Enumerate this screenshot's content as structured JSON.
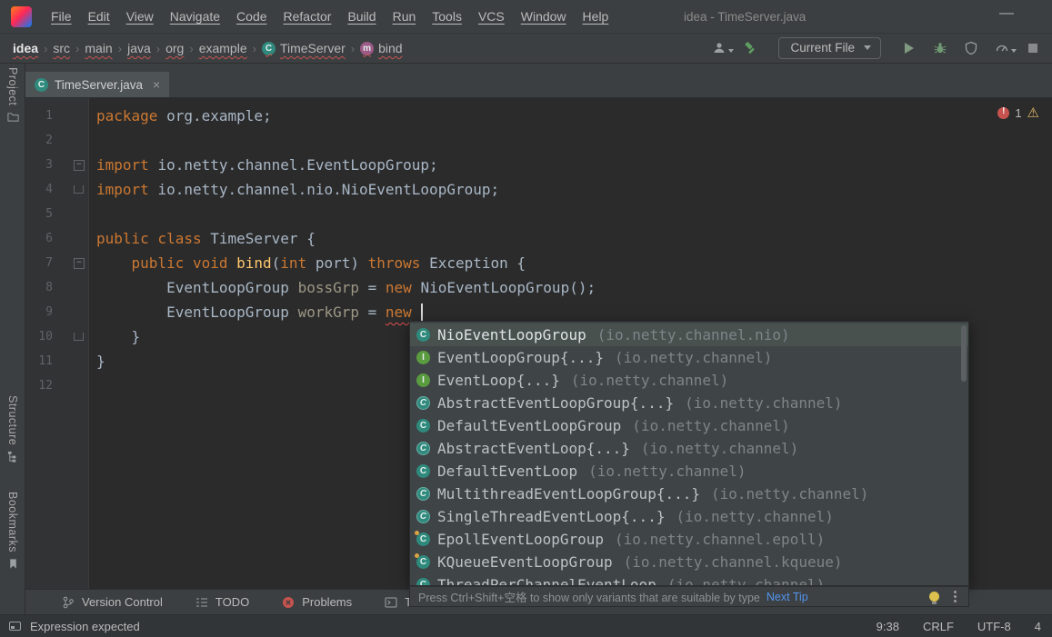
{
  "colors": {
    "panel": "#3c3f41",
    "editor_bg": "#2b2b2b",
    "keyword": "#cc7832",
    "error": "#c7534f",
    "warning": "#e8bf6a",
    "link": "#5394ec"
  },
  "title_bar": {
    "menus": [
      "File",
      "Edit",
      "View",
      "Navigate",
      "Code",
      "Refactor",
      "Build",
      "Run",
      "Tools",
      "VCS",
      "Window",
      "Help"
    ],
    "title": "idea - TimeServer.java",
    "minimize_glyph": "—"
  },
  "nav_bar": {
    "separator_glyph": "›",
    "breadcrumbs": [
      {
        "label": "idea"
      },
      {
        "label": "src"
      },
      {
        "label": "main"
      },
      {
        "label": "java"
      },
      {
        "label": "org"
      },
      {
        "label": "example"
      },
      {
        "label": "TimeServer",
        "icon": "class"
      },
      {
        "label": "bind",
        "icon": "method"
      }
    ],
    "run_config_label": "Current File"
  },
  "editor_tab": {
    "label": "TimeServer.java",
    "close_glyph": "×"
  },
  "left_stripe": {
    "project": "Project",
    "structure": "Structure",
    "bookmarks": "Bookmarks"
  },
  "icon_letters": {
    "class": "C",
    "interface": "I",
    "abstract": "C",
    "class-final": "C",
    "method": "m"
  },
  "editor": {
    "inspections": {
      "error_count": "1",
      "warning_glyph": "⚠"
    },
    "lines": [
      {
        "n": "1",
        "tokens": [
          {
            "t": "package ",
            "c": "kw"
          },
          {
            "t": "org.example;",
            "c": "pl"
          }
        ]
      },
      {
        "n": "2",
        "tokens": []
      },
      {
        "n": "3",
        "fold": "start",
        "tokens": [
          {
            "t": "import ",
            "c": "kw"
          },
          {
            "t": "io.netty.channel.EventLoopGroup;",
            "c": "pl"
          }
        ]
      },
      {
        "n": "4",
        "fold": "end",
        "tokens": [
          {
            "t": "import ",
            "c": "kw"
          },
          {
            "t": "io.netty.channel.nio.NioEventLoopGroup;",
            "c": "pl"
          }
        ]
      },
      {
        "n": "5",
        "tokens": []
      },
      {
        "n": "6",
        "tokens": [
          {
            "t": "public class ",
            "c": "kw"
          },
          {
            "t": "TimeServer {",
            "c": "pl"
          }
        ]
      },
      {
        "n": "7",
        "fold": "start",
        "tokens": [
          {
            "t": "    ",
            "c": "pl"
          },
          {
            "t": "public void ",
            "c": "kw"
          },
          {
            "t": "bind",
            "c": "fn"
          },
          {
            "t": "(",
            "c": "pl"
          },
          {
            "t": "int",
            "c": "kw"
          },
          {
            "t": " port) ",
            "c": "pl"
          },
          {
            "t": "throws ",
            "c": "kw"
          },
          {
            "t": "Exception {",
            "c": "pl"
          }
        ]
      },
      {
        "n": "8",
        "tokens": [
          {
            "t": "        EventLoopGroup ",
            "c": "pl"
          },
          {
            "t": "bossGrp",
            "c": "var"
          },
          {
            "t": " = ",
            "c": "pl"
          },
          {
            "t": "new ",
            "c": "kw"
          },
          {
            "t": "NioEventLoopGroup();",
            "c": "pl"
          }
        ]
      },
      {
        "n": "9",
        "caret": true,
        "tokens": [
          {
            "t": "        EventLoopGroup ",
            "c": "pl"
          },
          {
            "t": "workGrp",
            "c": "var"
          },
          {
            "t": " = ",
            "c": "pl"
          },
          {
            "t": "new ",
            "c": "kw err"
          }
        ]
      },
      {
        "n": "10",
        "fold": "end",
        "tokens": [
          {
            "t": "    }",
            "c": "pl"
          }
        ]
      },
      {
        "n": "11",
        "tokens": [
          {
            "t": "}",
            "c": "pl"
          }
        ]
      },
      {
        "n": "12",
        "tokens": []
      }
    ]
  },
  "completion": {
    "items": [
      {
        "name": "NioEventLoopGroup",
        "pkg": "(io.netty.channel.nio)",
        "icon": "class",
        "selected": true
      },
      {
        "name": "EventLoopGroup{...}",
        "pkg": "(io.netty.channel)",
        "icon": "interface"
      },
      {
        "name": "EventLoop{...}",
        "pkg": "(io.netty.channel)",
        "icon": "interface"
      },
      {
        "name": "AbstractEventLoopGroup{...}",
        "pkg": "(io.netty.channel)",
        "icon": "abstract"
      },
      {
        "name": "DefaultEventLoopGroup",
        "pkg": "(io.netty.channel)",
        "icon": "class"
      },
      {
        "name": "AbstractEventLoop{...}",
        "pkg": "(io.netty.channel)",
        "icon": "abstract"
      },
      {
        "name": "DefaultEventLoop",
        "pkg": "(io.netty.channel)",
        "icon": "class"
      },
      {
        "name": "MultithreadEventLoopGroup{...}",
        "pkg": "(io.netty.channel)",
        "icon": "abstract"
      },
      {
        "name": "SingleThreadEventLoop{...}",
        "pkg": "(io.netty.channel)",
        "icon": "abstract"
      },
      {
        "name": "EpollEventLoopGroup",
        "pkg": "(io.netty.channel.epoll)",
        "icon": "class-final"
      },
      {
        "name": "KQueueEventLoopGroup",
        "pkg": "(io.netty.channel.kqueue)",
        "icon": "class-final"
      },
      {
        "name": "ThreadPerChannelEventLoop",
        "pkg": "(io.netty.channel)",
        "icon": "class"
      }
    ],
    "hint": "Press Ctrl+Shift+空格 to show only variants that are suitable by type",
    "next_tip_label": "Next Tip"
  },
  "bottom_toolbar": {
    "buttons": [
      {
        "label": "Version Control",
        "icon": "branch"
      },
      {
        "label": "TODO",
        "icon": "checklist"
      },
      {
        "label": "Problems",
        "icon": "error-circle"
      },
      {
        "label": "Terminal",
        "icon": "terminal"
      }
    ]
  },
  "status_bar": {
    "message": "Expression expected",
    "caret_position": "9:38",
    "line_separator": "CRLF",
    "encoding": "UTF-8",
    "indent": "4"
  }
}
